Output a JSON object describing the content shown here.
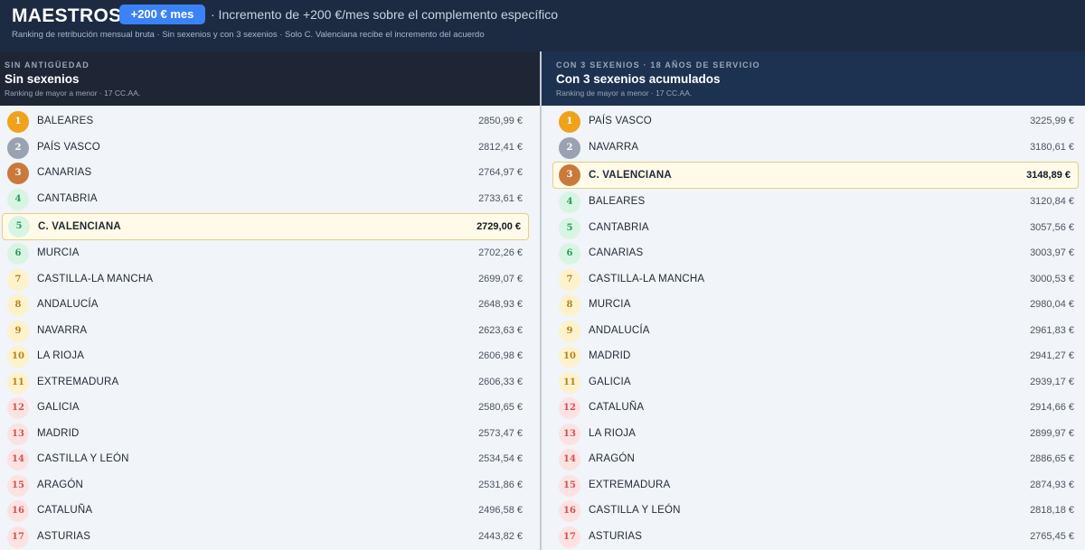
{
  "header": {
    "title": "MAESTROS",
    "badge": "+200 € mes",
    "headline": "· Incremento de +200 €/mes sobre el complemento específico",
    "subline": "Ranking de retribución mensual bruta · Sin sexenios y con 3 sexenios · Solo C. Valenciana recibe el incremento del acuerdo"
  },
  "left": {
    "kicker": "SIN ANTIGÜEDAD",
    "title": "Sin sexenios",
    "subtitle": "Ranking de mayor a menor · 17 CC.AA.",
    "rows": [
      {
        "rank": "1",
        "name": "BALEARES",
        "value": "2850,99 €",
        "medal": "gold",
        "highlight": false
      },
      {
        "rank": "2",
        "name": "PAÍS VASCO",
        "value": "2812,41 €",
        "medal": "silver",
        "highlight": false
      },
      {
        "rank": "3",
        "name": "CANARIAS",
        "value": "2764,97 €",
        "medal": "bronze",
        "highlight": false
      },
      {
        "rank": "4",
        "name": "CANTABRIA",
        "value": "2733,61 €",
        "medal": "green",
        "highlight": false
      },
      {
        "rank": "5",
        "name": "C. VALENCIANA",
        "value": "2729,00 €",
        "medal": "green",
        "highlight": true
      },
      {
        "rank": "6",
        "name": "MURCIA",
        "value": "2702,26 €",
        "medal": "green",
        "highlight": false
      },
      {
        "rank": "7",
        "name": "CASTILLA-LA MANCHA",
        "value": "2699,07 €",
        "medal": "yellow",
        "highlight": false
      },
      {
        "rank": "8",
        "name": "ANDALUCÍA",
        "value": "2648,93 €",
        "medal": "yellow",
        "highlight": false
      },
      {
        "rank": "9",
        "name": "NAVARRA",
        "value": "2623,63 €",
        "medal": "yellow",
        "highlight": false
      },
      {
        "rank": "10",
        "name": "LA RIOJA",
        "value": "2606,98 €",
        "medal": "yellow",
        "highlight": false
      },
      {
        "rank": "11",
        "name": "EXTREMADURA",
        "value": "2606,33 €",
        "medal": "yellow",
        "highlight": false
      },
      {
        "rank": "12",
        "name": "GALICIA",
        "value": "2580,65 €",
        "medal": "pink",
        "highlight": false
      },
      {
        "rank": "13",
        "name": "MADRID",
        "value": "2573,47 €",
        "medal": "pink",
        "highlight": false
      },
      {
        "rank": "14",
        "name": "CASTILLA Y LEÓN",
        "value": "2534,54 €",
        "medal": "pink",
        "highlight": false
      },
      {
        "rank": "15",
        "name": "ARAGÓN",
        "value": "2531,86 €",
        "medal": "pink",
        "highlight": false
      },
      {
        "rank": "16",
        "name": "CATALUÑA",
        "value": "2496,58 €",
        "medal": "pink",
        "highlight": false
      },
      {
        "rank": "17",
        "name": "ASTURIAS",
        "value": "2443,82 €",
        "medal": "pink",
        "highlight": false
      }
    ]
  },
  "right": {
    "kicker": "CON 3 SEXENIOS · 18 AÑOS DE SERVICIO",
    "title": "Con 3 sexenios acumulados",
    "subtitle": "Ranking de mayor a menor · 17 CC.AA.",
    "rows": [
      {
        "rank": "1",
        "name": "PAÍS VASCO",
        "value": "3225,99 €",
        "medal": "gold",
        "highlight": false
      },
      {
        "rank": "2",
        "name": "NAVARRA",
        "value": "3180,61 €",
        "medal": "silver",
        "highlight": false
      },
      {
        "rank": "3",
        "name": "C. VALENCIANA",
        "value": "3148,89 €",
        "medal": "bronze",
        "highlight": true
      },
      {
        "rank": "4",
        "name": "BALEARES",
        "value": "3120,84 €",
        "medal": "green",
        "highlight": false
      },
      {
        "rank": "5",
        "name": "CANTABRIA",
        "value": "3057,56 €",
        "medal": "green",
        "highlight": false
      },
      {
        "rank": "6",
        "name": "CANARIAS",
        "value": "3003,97 €",
        "medal": "green",
        "highlight": false
      },
      {
        "rank": "7",
        "name": "CASTILLA-LA MANCHA",
        "value": "3000,53 €",
        "medal": "yellow",
        "highlight": false
      },
      {
        "rank": "8",
        "name": "MURCIA",
        "value": "2980,04 €",
        "medal": "yellow",
        "highlight": false
      },
      {
        "rank": "9",
        "name": "ANDALUCÍA",
        "value": "2961,83 €",
        "medal": "yellow",
        "highlight": false
      },
      {
        "rank": "10",
        "name": "MADRID",
        "value": "2941,27 €",
        "medal": "yellow",
        "highlight": false
      },
      {
        "rank": "11",
        "name": "GALICIA",
        "value": "2939,17 €",
        "medal": "yellow",
        "highlight": false
      },
      {
        "rank": "12",
        "name": "CATALUÑA",
        "value": "2914,66 €",
        "medal": "pink",
        "highlight": false
      },
      {
        "rank": "13",
        "name": "LA RIOJA",
        "value": "2899,97 €",
        "medal": "pink",
        "highlight": false
      },
      {
        "rank": "14",
        "name": "ARAGÓN",
        "value": "2886,65 €",
        "medal": "pink",
        "highlight": false
      },
      {
        "rank": "15",
        "name": "EXTREMADURA",
        "value": "2874,93 €",
        "medal": "pink",
        "highlight": false
      },
      {
        "rank": "16",
        "name": "CASTILLA Y LEÓN",
        "value": "2818,18 €",
        "medal": "pink",
        "highlight": false
      },
      {
        "rank": "17",
        "name": "ASTURIAS",
        "value": "2765,45 €",
        "medal": "pink",
        "highlight": false
      }
    ]
  },
  "colors": {
    "header_bg": "#1c2b42",
    "badge_bg": "#3b82f6",
    "left_header_bg": "#1e2534",
    "right_header_bg": "#1d3150",
    "highlight_bg": "#fffbe8",
    "highlight_border": "#e8cd84",
    "gold": "#f0a21b",
    "silver": "#99a2b1",
    "bronze": "#c97a3b"
  }
}
